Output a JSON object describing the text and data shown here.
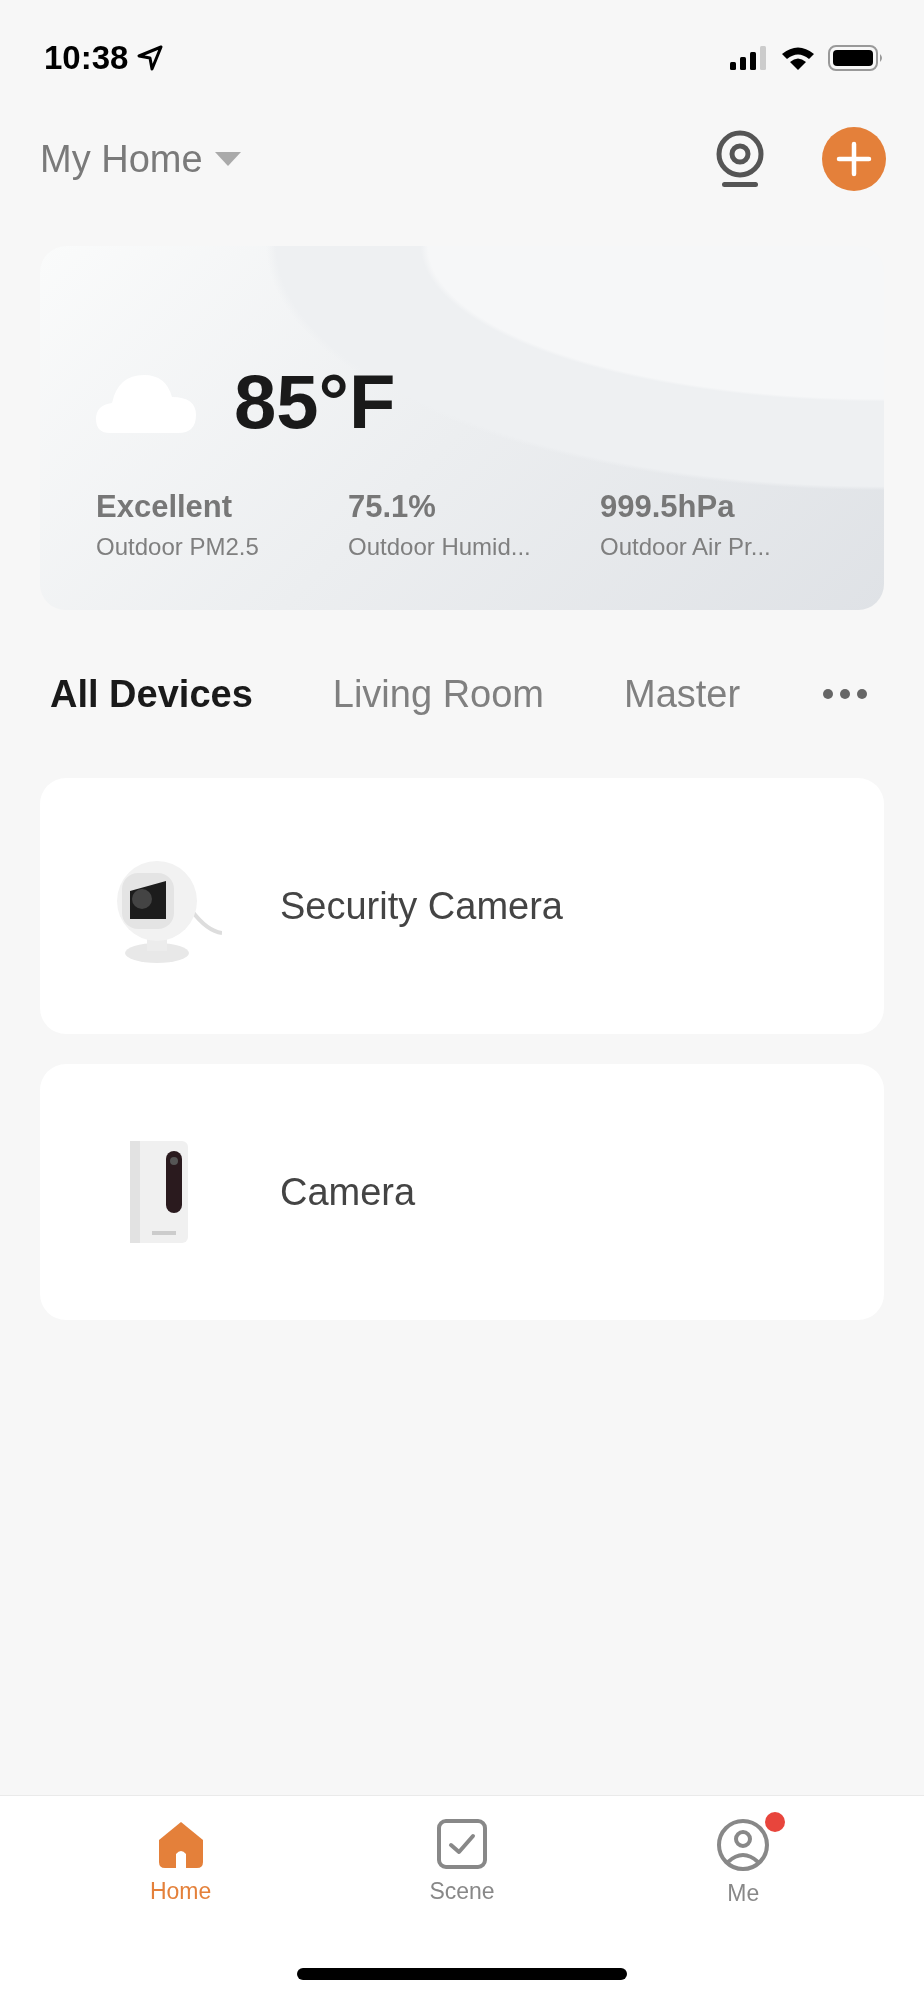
{
  "status_bar": {
    "time": "10:38"
  },
  "header": {
    "home_name": "My Home"
  },
  "weather": {
    "temperature": "85°F",
    "stats": [
      {
        "value": "Excellent",
        "label": "Outdoor PM2.5"
      },
      {
        "value": "75.1%",
        "label": "Outdoor Humid..."
      },
      {
        "value": "999.5hPa",
        "label": "Outdoor Air Pr..."
      }
    ]
  },
  "rooms": [
    {
      "label": "All Devices",
      "selected": true
    },
    {
      "label": "Living Room",
      "selected": false
    },
    {
      "label": "Master",
      "selected": false
    }
  ],
  "devices": [
    {
      "name": "Security Camera",
      "kind": "picture"
    },
    {
      "name": "Camera",
      "kind": "picture"
    }
  ],
  "tab_bar": [
    {
      "label": "Home",
      "selected": true,
      "notification": false
    },
    {
      "label": "Scene",
      "selected": false,
      "notification": false
    },
    {
      "label": "Me",
      "selected": false,
      "notification": true
    }
  ]
}
